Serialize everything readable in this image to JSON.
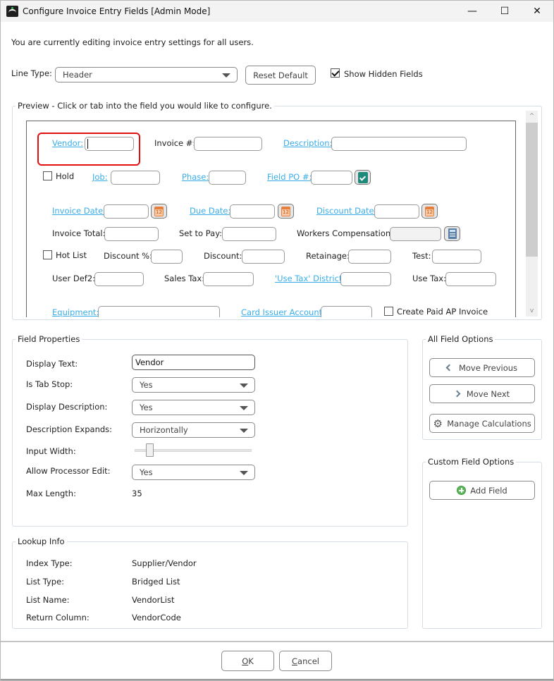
{
  "window": {
    "title": "Configure Invoice Entry Fields [Admin Mode]",
    "controls": {
      "minimize": "—",
      "maximize": "☐",
      "close": "✕"
    }
  },
  "intro_text": "You are currently editing invoice entry settings for all users.",
  "toolbar": {
    "line_type_label": "Line Type:",
    "line_type_value": "Header",
    "reset_default_label": "Reset Default",
    "show_hidden_fields_label": "Show Hidden Fields",
    "show_hidden_fields_checked": true
  },
  "preview": {
    "title": "Preview - Click or tab into the field you would like to configure.",
    "selected_field": "Vendor",
    "fields": {
      "vendor": "Vendor:",
      "invoice_num": "Invoice #:",
      "description": "Description:",
      "hold": "Hold",
      "job": "Job:",
      "phase": "Phase:",
      "field_po": "Field PO #:",
      "invoice_date": "Invoice Date:",
      "due_date": "Due Date:",
      "discount_date": "Discount Date:",
      "invoice_total": "Invoice Total:",
      "set_to_pay": "Set to Pay:",
      "workers_comp": "Workers Compensation:",
      "hot_list": "Hot List",
      "discount_pct": "Discount %:",
      "discount": "Discount:",
      "retainage": "Retainage:",
      "test": "Test:",
      "user_def2": "User Def2:",
      "sales_tax": "Sales Tax:",
      "use_tax_district": "'Use Tax' District:",
      "use_tax": "Use Tax:",
      "equipment": "Equipment:",
      "card_issuer_account": "Card Issuer Account:",
      "create_paid_ap_invoice": "Create Paid AP Invoice"
    },
    "scroll_up": "^",
    "scroll_down": "v"
  },
  "field_properties": {
    "title": "Field Properties",
    "display_text_label": "Display Text:",
    "display_text_value": "Vendor",
    "is_tab_stop_label": "Is Tab Stop:",
    "is_tab_stop_value": "Yes",
    "display_description_label": "Display Description:",
    "display_description_value": "Yes",
    "description_expands_label": "Description Expands:",
    "description_expands_value": "Horizontally",
    "input_width_label": "Input Width:",
    "input_width_fraction": 0.1,
    "allow_processor_edit_label": "Allow Processor Edit:",
    "allow_processor_edit_value": "Yes",
    "max_length_label": "Max Length:",
    "max_length_value": "35"
  },
  "lookup_info": {
    "title": "Lookup Info",
    "rows": [
      {
        "label": "Index Type:",
        "value": "Supplier/Vendor"
      },
      {
        "label": "List Type:",
        "value": "Bridged List"
      },
      {
        "label": "List Name:",
        "value": "VendorList"
      },
      {
        "label": "Return Column:",
        "value": "VendorCode"
      }
    ]
  },
  "all_field_options": {
    "title": "All Field Options",
    "move_previous": "Move Previous",
    "move_next": "Move Next",
    "manage_calculations": "Manage Calculations"
  },
  "custom_field_options": {
    "title": "Custom Field Options",
    "add_field": "Add Field"
  },
  "footer": {
    "ok_mnemonic": "O",
    "ok_rest": "K",
    "cancel_mnemonic": "C",
    "cancel_rest": "ancel"
  }
}
